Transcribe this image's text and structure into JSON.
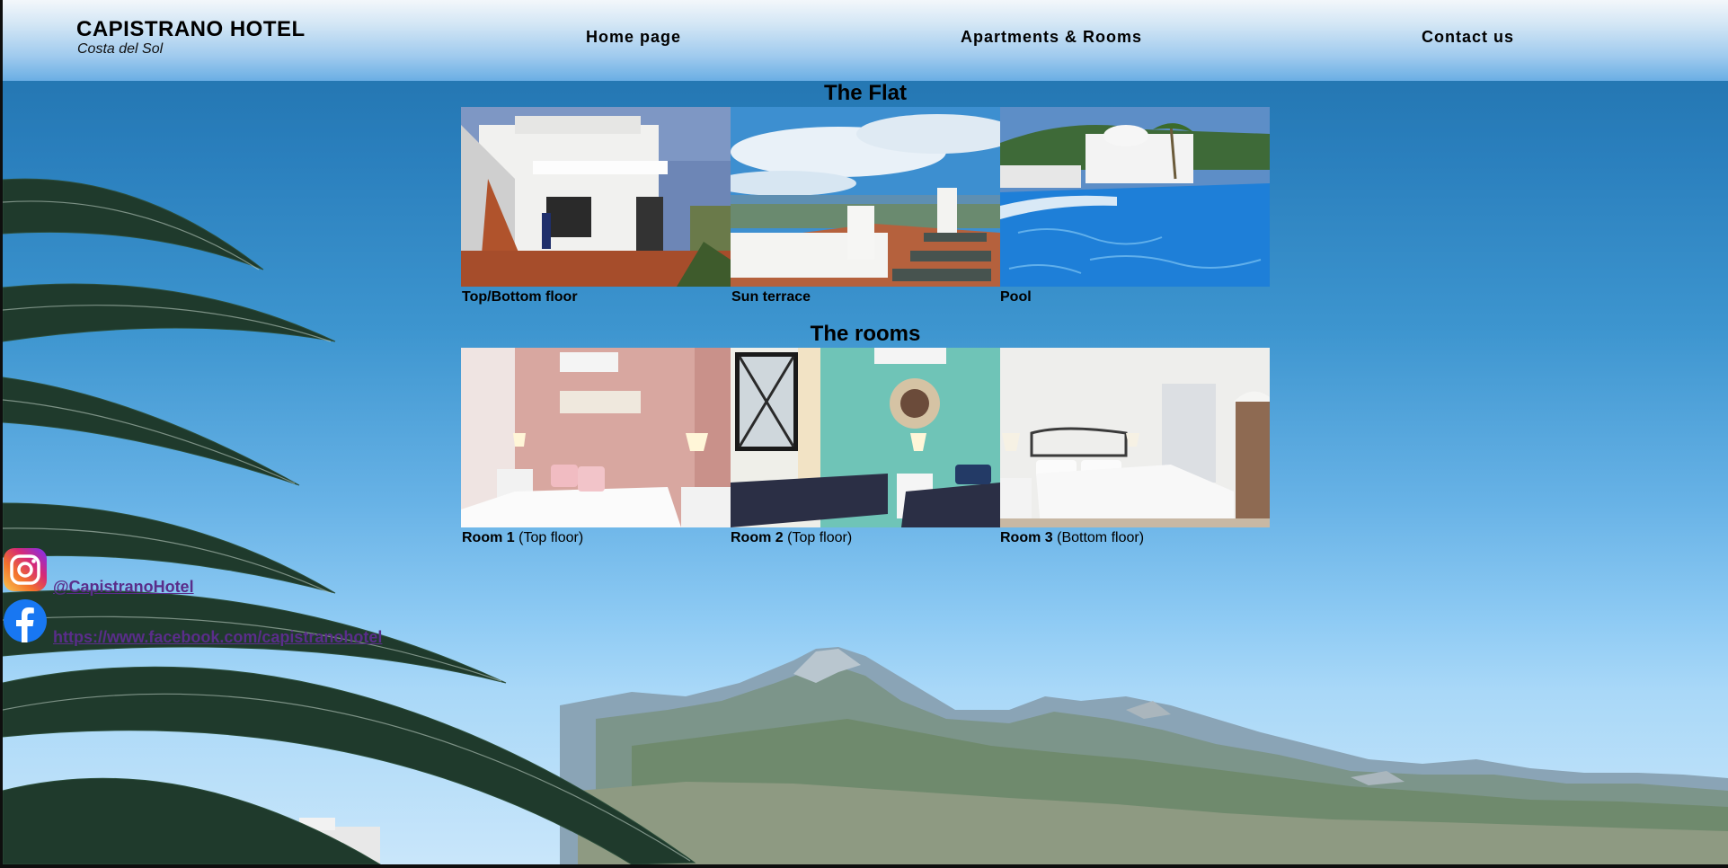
{
  "header": {
    "brand_title": "CAPISTRANO HOTEL",
    "brand_subtitle": "Costa del Sol",
    "nav": [
      {
        "label": "Home page"
      },
      {
        "label": "Apartments & Rooms"
      },
      {
        "label": "Contact us"
      }
    ]
  },
  "flat": {
    "title": "The Flat",
    "photos": [
      {
        "caption": "Top/Bottom floor"
      },
      {
        "caption": "Sun terrace"
      },
      {
        "caption": "Pool"
      }
    ]
  },
  "rooms": {
    "title": "The rooms",
    "photos": [
      {
        "name": "Room 1",
        "detail": " (Top floor)"
      },
      {
        "name": "Room 2",
        "detail": " (Top floor)"
      },
      {
        "name": "Room 3",
        "detail": " (Bottom floor)"
      }
    ]
  },
  "social": {
    "instagram": {
      "icon": "instagram-icon",
      "label": "@CapistranoHotel"
    },
    "facebook": {
      "icon": "facebook-icon",
      "label": "https://www.facebook.com/capistranohotel"
    }
  },
  "colors": {
    "header_top": "#f3f7fb",
    "header_bottom": "#6aaee4",
    "sky": "#2a7fbd",
    "link_visited": "#5a2d8a",
    "facebook": "#1877f2"
  }
}
